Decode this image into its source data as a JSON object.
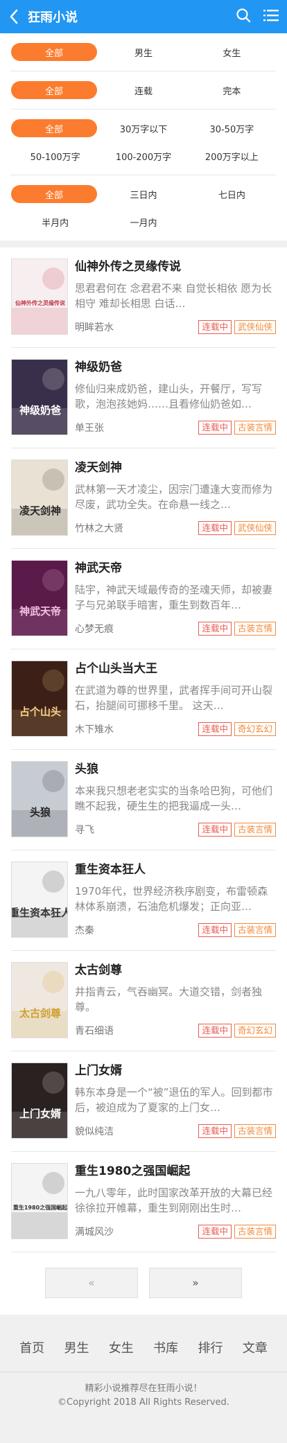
{
  "header": {
    "title": "狂雨小说"
  },
  "filters": [
    {
      "options": [
        "全部",
        "男生",
        "女生"
      ]
    },
    {
      "options": [
        "全部",
        "连载",
        "完本"
      ]
    },
    {
      "options": [
        "全部",
        "30万字以下",
        "30-50万字",
        "50-100万字",
        "100-200万字",
        "200万字以上"
      ]
    },
    {
      "options": [
        "全部",
        "三日内",
        "七日内",
        "半月内",
        "一月内"
      ]
    }
  ],
  "books": [
    {
      "title": "仙神外传之灵缘传说",
      "desc": "思君君何在 念君君不来 自觉长相依 愿为长相守 难却长相思 白话…",
      "author": "明眸若水",
      "status": "连载中",
      "genre": "武侠仙侠"
    },
    {
      "title": "神级奶爸",
      "desc": "修仙归来成奶爸，建山头，开餐厅，写写歌，泡泡孩她妈……且看修仙奶爸如…",
      "author": "单王张",
      "status": "连载中",
      "genre": "古装言情"
    },
    {
      "title": "凌天剑神",
      "desc": "武林第一天才凌尘，因宗门遭逢大变而修为尽废，武功全失。在命悬一线之…",
      "author": "竹林之大贤",
      "status": "连载中",
      "genre": "武侠仙侠"
    },
    {
      "title": "神武天帝",
      "desc": "陆宇，神武天域最传奇的圣魂天师，却被妻子与兄弟联手暗害，重生到数百年…",
      "author": "心梦无痕",
      "status": "连载中",
      "genre": "古装言情"
    },
    {
      "title": "占个山头当大王",
      "desc": "在武道为尊的世界里，武者挥手间可开山裂石，抬腿间可挪移千里。 这天…",
      "author": "木下雉水",
      "status": "连载中",
      "genre": "奇幻玄幻"
    },
    {
      "title": "头狼",
      "desc": "本来我只想老老实实的当条哈巴狗，可他们瞧不起我，硬生生的把我逼成一头…",
      "author": "寻飞",
      "status": "连载中",
      "genre": "古装言情"
    },
    {
      "title": "重生资本狂人",
      "desc": "1970年代，世界经济秩序剧变，布雷顿森林体系崩溃，石油危机爆发；正向亚…",
      "author": "杰秦",
      "status": "连载中",
      "genre": "古装言情"
    },
    {
      "title": "太古剑尊",
      "desc": "井指青云，气吞幽冥。大道交错，剑者独尊。",
      "author": "青石细语",
      "status": "连载中",
      "genre": "奇幻玄幻"
    },
    {
      "title": "上门女婿",
      "desc": "韩东本身是一个“被”退伍的军人。回到都市后，被迫成为了夏家的上门女…",
      "author": "貌似纯洁",
      "status": "连载中",
      "genre": "古装言情"
    },
    {
      "title": "重生1980之强国崛起",
      "desc": "一九八零年，此时国家改革开放的大幕已经徐徐拉开帷幕，重生到刚刚出生时…",
      "author": "满城风沙",
      "status": "连载中",
      "genre": "古装言情"
    }
  ],
  "covers": [
    {
      "text": "仙神外传之灵缘传说",
      "bg": "#f7eef0",
      "fg": "#c23a4a"
    },
    {
      "text": "神级奶爸",
      "bg": "#3a2f4a",
      "fg": "#ffffff"
    },
    {
      "text": "凌天剑神",
      "bg": "#e9e2d4",
      "fg": "#2a2a2a"
    },
    {
      "text": "神武天帝",
      "bg": "#5a1a4a",
      "fg": "#f3c0e0"
    },
    {
      "text": "占个山头",
      "bg": "#3c2018",
      "fg": "#f6d08a"
    },
    {
      "text": "头狼",
      "bg": "#c7cbd2",
      "fg": "#222222"
    },
    {
      "text": "重生资本狂人",
      "bg": "#f4f4f4",
      "fg": "#333333"
    },
    {
      "text": "太古剑尊",
      "bg": "#efe8e0",
      "fg": "#d0a030"
    },
    {
      "text": "上门女婿",
      "bg": "#2a2220",
      "fg": "#ffffff"
    },
    {
      "text": "重生1980之强国崛起",
      "bg": "#f4f4f4",
      "fg": "#333333"
    }
  ],
  "pager": {
    "prev": "«",
    "next": "»"
  },
  "footer": {
    "nav": [
      "首页",
      "男生",
      "女生",
      "书库",
      "排行",
      "文章"
    ],
    "line1": "精彩小说推荐尽在狂雨小说！",
    "line2": "©Copyright 2018 All Rights Reserved."
  },
  "colors": {
    "header": "#2196f3",
    "active": "#fb7c2e",
    "tag_status": "#e85a50",
    "tag_genre": "#f08a3a"
  }
}
